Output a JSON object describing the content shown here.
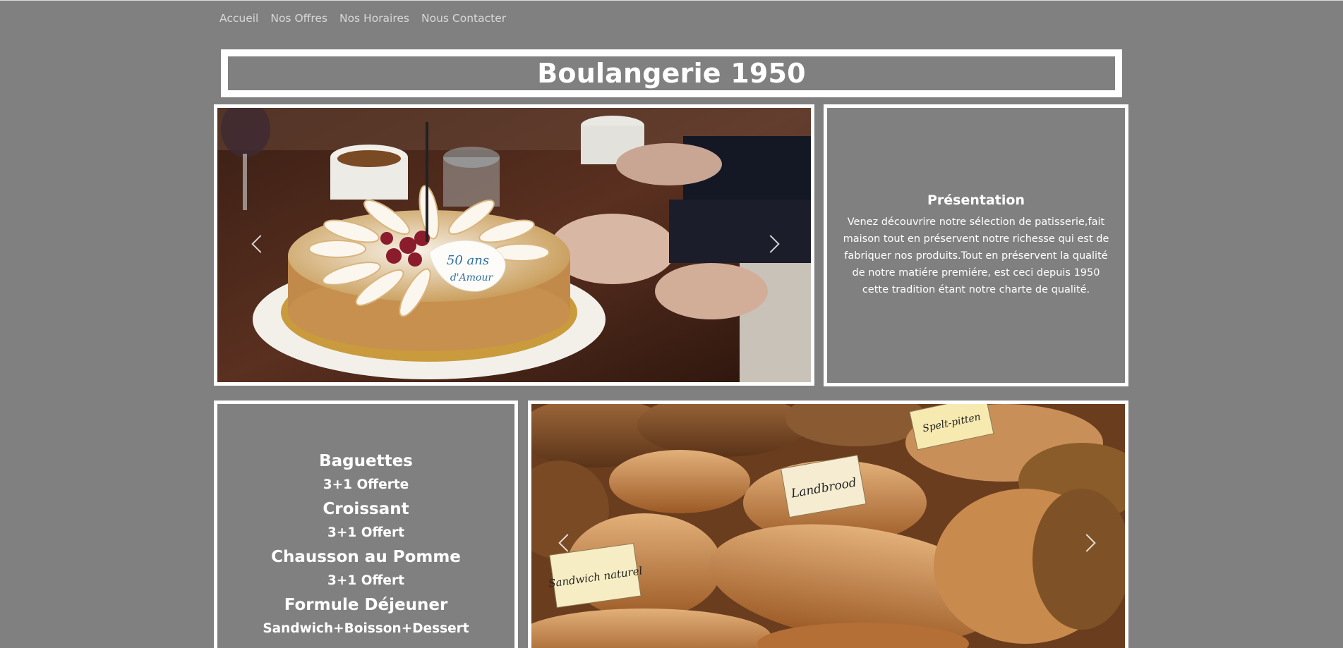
{
  "nav": {
    "items": [
      "Accueil",
      "Nos Offres",
      "Nos Horaires",
      "Nous Contacter"
    ]
  },
  "header": {
    "title": "Boulangerie 1950"
  },
  "carousel_top": {
    "image": "birthday-cake-photo",
    "cake_text_line1": "50 ans",
    "cake_text_line2": "d'Amour",
    "prev_icon": "chevron-left-icon",
    "next_icon": "chevron-right-icon"
  },
  "presentation": {
    "heading": "Présentation",
    "body": "Venez découvrire notre sélection de patisserie,fait maison tout en préservent notre richesse qui est de fabriquer nos produits.Tout en préservent la qualité de notre matiére premiére, est ceci depuis 1950 cette tradition étant notre charte de qualité."
  },
  "offers": {
    "items": [
      {
        "name": "Baguettes",
        "deal": "3+1 Offerte"
      },
      {
        "name": "Croissant",
        "deal": "3+1 Offert"
      },
      {
        "name": "Chausson au Pomme",
        "deal": "3+1 Offert"
      },
      {
        "name": "Formule Déjeuner",
        "deal": "Sandwich+Boisson+Dessert"
      }
    ]
  },
  "carousel_bottom": {
    "image": "bread-loaves-photo",
    "tags": [
      "Landbrood",
      "Sandwich naturel",
      "Spelt-pitten"
    ],
    "prev_icon": "chevron-left-icon",
    "next_icon": "chevron-right-icon"
  },
  "colors": {
    "background": "#808080",
    "border": "#ffffff",
    "text": "#ffffff",
    "nav_text": "#d8d8d8"
  }
}
